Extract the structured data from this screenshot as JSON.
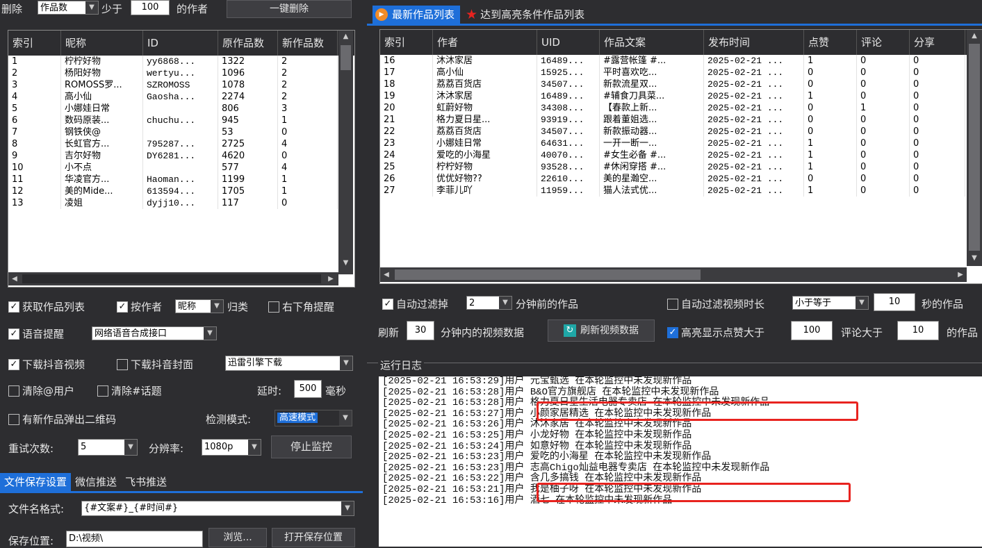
{
  "left_top": {
    "delete_label": "删除",
    "delete_field": "作品数",
    "less_than_label": "少于",
    "threshold": "100",
    "of_author_label": "的作者",
    "delete_all_button": "一键删除"
  },
  "author_table": {
    "columns": [
      "索引",
      "昵称",
      "ID",
      "原作品数",
      "新作品数"
    ],
    "rows": [
      [
        "1",
        "柠柠好物",
        "yy6868...",
        "1322",
        "2"
      ],
      [
        "2",
        "杨阳好物",
        "wertyu...",
        "1096",
        "2"
      ],
      [
        "3",
        "ROMOSS罗...",
        "SZROMOSS",
        "1078",
        "2"
      ],
      [
        "4",
        "高小仙",
        "Gaosha...",
        "2274",
        "2"
      ],
      [
        "5",
        "小娜娃日常",
        "",
        "806",
        "3"
      ],
      [
        "6",
        "数码原装...",
        "chuchu...",
        "945",
        "1"
      ],
      [
        "7",
        "钢铁侠@",
        "",
        "53",
        "0"
      ],
      [
        "8",
        "长虹官方...",
        "795287...",
        "2725",
        "4"
      ],
      [
        "9",
        "吉尔好物",
        "DY6281...",
        "4620",
        "0"
      ],
      [
        "10",
        "小不点",
        "",
        "577",
        "4"
      ],
      [
        "11",
        "华凌官方...",
        "Haoman...",
        "1199",
        "1"
      ],
      [
        "12",
        "美的Mide...",
        "613594...",
        "1705",
        "1"
      ],
      [
        "13",
        "凌姐",
        "dyjj10...",
        "117",
        "0"
      ]
    ]
  },
  "options": {
    "get_list": "获取作品列表",
    "by_author": "按作者",
    "by_author_field": "昵称",
    "group": "归类",
    "corner_notify": "右下角提醒",
    "voice_notify": "语音提醒",
    "voice_engine": "网络语音合成接口",
    "download_video": "下载抖音视频",
    "download_cover": "下载抖音封面",
    "downloader": "迅雷引擎下载",
    "remove_at": "清除@用户",
    "remove_topic": "清除#话题",
    "delay_label": "延时:",
    "delay_value": "500",
    "delay_unit": "毫秒",
    "qr_popup": "有新作品弹出二维码",
    "detect_mode_label": "检测模式:",
    "detect_mode": "高速模式",
    "retry_label": "重试次数:",
    "retry_value": "5",
    "resolution_label": "分辨率:",
    "resolution_value": "1080p",
    "stop_button": "停止监控"
  },
  "bottom_tabs": [
    "文件保存设置",
    "微信推送",
    "飞书推送"
  ],
  "file": {
    "name_format_label": "文件名格式:",
    "name_format": "{#文案#}_{#时间#}",
    "save_path_label": "保存位置:",
    "save_path": "D:\\视频\\",
    "browse_button": "浏览...",
    "open_button": "打开保存位置"
  },
  "right_tabs": [
    "最新作品列表",
    "达到高亮条件作品列表"
  ],
  "works_table": {
    "columns": [
      "索引",
      "作者",
      "UID",
      "作品文案",
      "发布时间",
      "点赞",
      "评论",
      "分享"
    ],
    "rows": [
      [
        "16",
        "沐沐家居",
        "16489...",
        "#露营帐篷 #...",
        "2025-02-21 ...",
        "1",
        "0",
        "0"
      ],
      [
        "17",
        "高小仙",
        "15925...",
        "平时喜欢吃...",
        "2025-02-21 ...",
        "0",
        "0",
        "0"
      ],
      [
        "18",
        "荔荔百货店",
        "34507...",
        "新款流星双...",
        "2025-02-21 ...",
        "0",
        "0",
        "0"
      ],
      [
        "19",
        "沐沐家居",
        "16489...",
        "#辅食刀具菜...",
        "2025-02-21 ...",
        "1",
        "0",
        "0"
      ],
      [
        "20",
        "虹蔚好物",
        "34308...",
        "【春款上新...",
        "2025-02-21 ...",
        "0",
        "1",
        "0"
      ],
      [
        "21",
        "格力夏日星...",
        "93919...",
        "跟着董姐选...",
        "2025-02-21 ...",
        "0",
        "0",
        "0"
      ],
      [
        "22",
        "荔荔百货店",
        "34507...",
        "新款振动器...",
        "2025-02-21 ...",
        "0",
        "0",
        "0"
      ],
      [
        "23",
        "小娜娃日常",
        "64631...",
        "一开一断一...",
        "2025-02-21 ...",
        "1",
        "0",
        "0"
      ],
      [
        "24",
        "爱吃的小海星",
        "40070...",
        "#女生必备 #...",
        "2025-02-21 ...",
        "1",
        "0",
        "0"
      ],
      [
        "25",
        "柠柠好物",
        "93528...",
        "#休闲穿搭 #...",
        "2025-02-21 ...",
        "1",
        "0",
        "0"
      ],
      [
        "26",
        "优优好物??",
        "22610...",
        "美的星瀚空...",
        "2025-02-21 ...",
        "0",
        "0",
        "0"
      ],
      [
        "27",
        "李菲儿吖",
        "11959...",
        "猫人法式优...",
        "2025-02-21 ...",
        "1",
        "0",
        "0"
      ]
    ]
  },
  "filters": {
    "auto_filter": "自动过滤掉",
    "auto_filter_value": "2",
    "auto_filter_suffix": "分钟前的作品",
    "duration_filter": "自动过滤视频时长",
    "duration_op": "小于等于",
    "duration_value": "10",
    "duration_suffix": "秒的作品",
    "refresh_label": "刷新",
    "refresh_minutes": "30",
    "refresh_suffix": "分钟内的视频数据",
    "refresh_button": "刷新视频数据",
    "highlight_label": "高亮显示点赞大于",
    "highlight_likes": "100",
    "comments_label": "评论大于",
    "comments_value": "10",
    "works_suffix": "的作品"
  },
  "log": {
    "title": "运行日志",
    "lines": [
      "[2025-02-21 16:53:29]用户 元宝甄选 在本轮监控中未发现新作品",
      "[2025-02-21 16:53:28]用户 B&O官方旗舰店 在本轮监控中未发现新作品",
      "[2025-02-21 16:53:28]用户 格力夏日星生活电器专卖店 在本轮监控中未发现新作品",
      "[2025-02-21 16:53:27]用户 小颜家居精选 在本轮监控中未发现新作品",
      "[2025-02-21 16:53:26]用户 沐沐家居 在本轮监控中未发现新作品",
      "[2025-02-21 16:53:25]用户 小龙好物 在本轮监控中未发现新作品",
      "[2025-02-21 16:53:24]用户 如意好物 在本轮监控中未发现新作品",
      "[2025-02-21 16:53:23]用户 爱吃的小海星 在本轮监控中未发现新作品",
      "[2025-02-21 16:53:23]用户 志高Chigo灿益电器专卖店 在本轮监控中未发现新作品",
      "[2025-02-21 16:53:22]用户 含几多搞钱 在本轮监控中未发现新作品",
      "[2025-02-21 16:53:21]用户 我是柚子呀 在本轮监控中未发现新作品",
      "[2025-02-21 16:53:16]用户 酒七 在本轮监控中未发现新作品"
    ]
  }
}
